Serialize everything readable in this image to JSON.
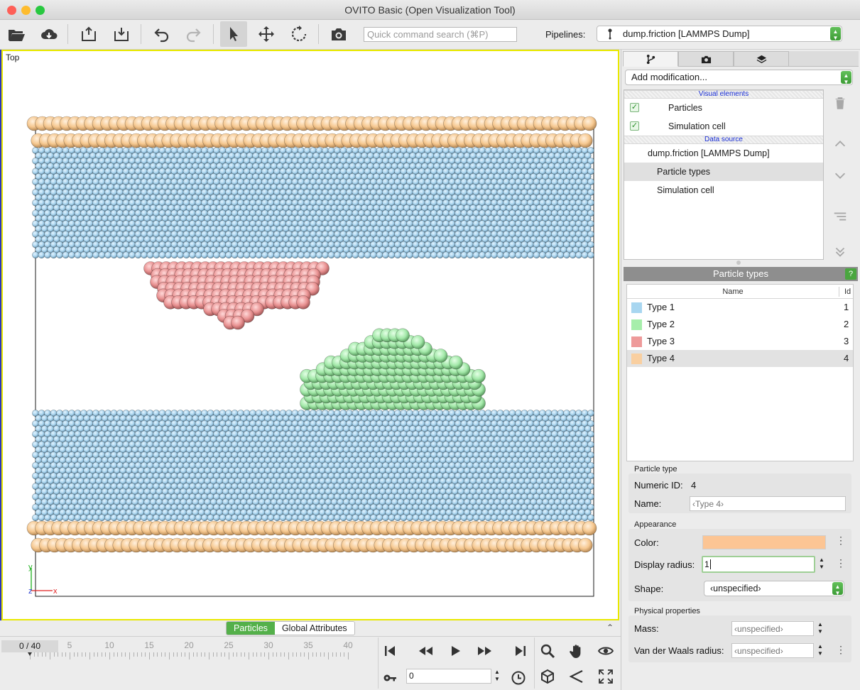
{
  "window": {
    "title": "OVITO Basic (Open Visualization Tool)"
  },
  "toolbar": {
    "search_placeholder": "Quick command search (⌘P)",
    "pipelines_label": "Pipelines:",
    "pipeline_selected": "dump.friction [LAMMPS Dump]"
  },
  "viewport": {
    "label": "Top",
    "axis_x": "x",
    "axis_y": "y",
    "axis_z": "z"
  },
  "panel": {
    "add_modification": "Add modification...",
    "pipeline": {
      "visual_elements_header": "Visual elements",
      "visual_elements": [
        {
          "label": "Particles",
          "checked": true
        },
        {
          "label": "Simulation cell",
          "checked": true
        }
      ],
      "data_source_header": "Data source",
      "data_source": "dump.friction [LAMMPS Dump]",
      "sub_items": [
        "Particle types",
        "Simulation cell"
      ]
    },
    "editor_title": "Particle types",
    "help": "?",
    "types_table": {
      "col_name": "Name",
      "col_id": "Id",
      "rows": [
        {
          "name": "Type 1",
          "id": "1",
          "color": "#a8d6f0"
        },
        {
          "name": "Type 2",
          "id": "2",
          "color": "#a6eeab"
        },
        {
          "name": "Type 3",
          "id": "3",
          "color": "#ee9a9a"
        },
        {
          "name": "Type 4",
          "id": "4",
          "color": "#f9cfa0"
        }
      ]
    },
    "particle_type": {
      "group": "Particle type",
      "numeric_id_label": "Numeric ID:",
      "numeric_id": "4",
      "name_label": "Name:",
      "name_placeholder": "‹Type 4›"
    },
    "appearance": {
      "group": "Appearance",
      "color_label": "Color:",
      "color": "#fcc594",
      "radius_label": "Display radius:",
      "radius_value": "1",
      "shape_label": "Shape:",
      "shape_value": "‹unspecified›"
    },
    "physical": {
      "group": "Physical properties",
      "mass_label": "Mass:",
      "mass_placeholder": "‹unspecified›",
      "vdw_label": "Van der Waals radius:",
      "vdw_placeholder": "‹unspecified›"
    }
  },
  "bottom": {
    "tabs": [
      "Particles",
      "Global Attributes"
    ],
    "frame_display": "0 / 40",
    "timeline_ticks": [
      "5",
      "10",
      "15",
      "20",
      "25",
      "30",
      "35",
      "40"
    ],
    "frame_value": "0"
  }
}
